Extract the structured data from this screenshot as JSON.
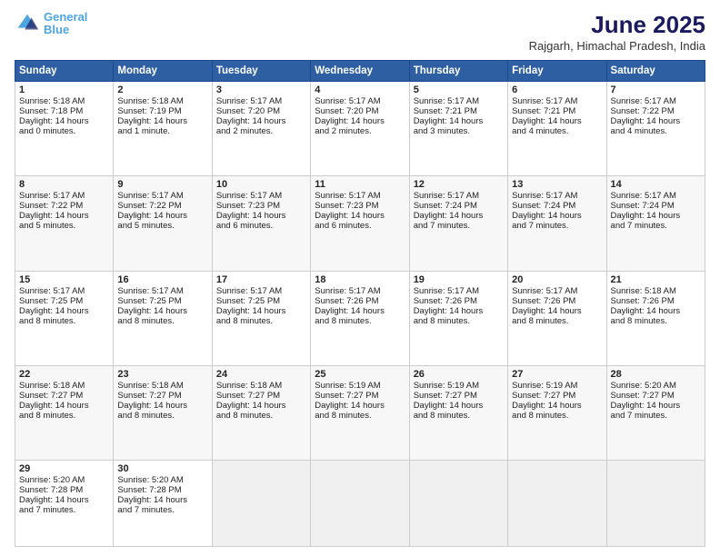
{
  "logo": {
    "line1": "General",
    "line2": "Blue"
  },
  "header": {
    "title": "June 2025",
    "subtitle": "Rajgarh, Himachal Pradesh, India"
  },
  "weekdays": [
    "Sunday",
    "Monday",
    "Tuesday",
    "Wednesday",
    "Thursday",
    "Friday",
    "Saturday"
  ],
  "weeks": [
    [
      {
        "day": "1",
        "lines": [
          "Sunrise: 5:18 AM",
          "Sunset: 7:18 PM",
          "Daylight: 14 hours",
          "and 0 minutes."
        ]
      },
      {
        "day": "2",
        "lines": [
          "Sunrise: 5:18 AM",
          "Sunset: 7:19 PM",
          "Daylight: 14 hours",
          "and 1 minute."
        ]
      },
      {
        "day": "3",
        "lines": [
          "Sunrise: 5:17 AM",
          "Sunset: 7:20 PM",
          "Daylight: 14 hours",
          "and 2 minutes."
        ]
      },
      {
        "day": "4",
        "lines": [
          "Sunrise: 5:17 AM",
          "Sunset: 7:20 PM",
          "Daylight: 14 hours",
          "and 2 minutes."
        ]
      },
      {
        "day": "5",
        "lines": [
          "Sunrise: 5:17 AM",
          "Sunset: 7:21 PM",
          "Daylight: 14 hours",
          "and 3 minutes."
        ]
      },
      {
        "day": "6",
        "lines": [
          "Sunrise: 5:17 AM",
          "Sunset: 7:21 PM",
          "Daylight: 14 hours",
          "and 4 minutes."
        ]
      },
      {
        "day": "7",
        "lines": [
          "Sunrise: 5:17 AM",
          "Sunset: 7:22 PM",
          "Daylight: 14 hours",
          "and 4 minutes."
        ]
      }
    ],
    [
      {
        "day": "8",
        "lines": [
          "Sunrise: 5:17 AM",
          "Sunset: 7:22 PM",
          "Daylight: 14 hours",
          "and 5 minutes."
        ]
      },
      {
        "day": "9",
        "lines": [
          "Sunrise: 5:17 AM",
          "Sunset: 7:22 PM",
          "Daylight: 14 hours",
          "and 5 minutes."
        ]
      },
      {
        "day": "10",
        "lines": [
          "Sunrise: 5:17 AM",
          "Sunset: 7:23 PM",
          "Daylight: 14 hours",
          "and 6 minutes."
        ]
      },
      {
        "day": "11",
        "lines": [
          "Sunrise: 5:17 AM",
          "Sunset: 7:23 PM",
          "Daylight: 14 hours",
          "and 6 minutes."
        ]
      },
      {
        "day": "12",
        "lines": [
          "Sunrise: 5:17 AM",
          "Sunset: 7:24 PM",
          "Daylight: 14 hours",
          "and 7 minutes."
        ]
      },
      {
        "day": "13",
        "lines": [
          "Sunrise: 5:17 AM",
          "Sunset: 7:24 PM",
          "Daylight: 14 hours",
          "and 7 minutes."
        ]
      },
      {
        "day": "14",
        "lines": [
          "Sunrise: 5:17 AM",
          "Sunset: 7:24 PM",
          "Daylight: 14 hours",
          "and 7 minutes."
        ]
      }
    ],
    [
      {
        "day": "15",
        "lines": [
          "Sunrise: 5:17 AM",
          "Sunset: 7:25 PM",
          "Daylight: 14 hours",
          "and 8 minutes."
        ]
      },
      {
        "day": "16",
        "lines": [
          "Sunrise: 5:17 AM",
          "Sunset: 7:25 PM",
          "Daylight: 14 hours",
          "and 8 minutes."
        ]
      },
      {
        "day": "17",
        "lines": [
          "Sunrise: 5:17 AM",
          "Sunset: 7:25 PM",
          "Daylight: 14 hours",
          "and 8 minutes."
        ]
      },
      {
        "day": "18",
        "lines": [
          "Sunrise: 5:17 AM",
          "Sunset: 7:26 PM",
          "Daylight: 14 hours",
          "and 8 minutes."
        ]
      },
      {
        "day": "19",
        "lines": [
          "Sunrise: 5:17 AM",
          "Sunset: 7:26 PM",
          "Daylight: 14 hours",
          "and 8 minutes."
        ]
      },
      {
        "day": "20",
        "lines": [
          "Sunrise: 5:17 AM",
          "Sunset: 7:26 PM",
          "Daylight: 14 hours",
          "and 8 minutes."
        ]
      },
      {
        "day": "21",
        "lines": [
          "Sunrise: 5:18 AM",
          "Sunset: 7:26 PM",
          "Daylight: 14 hours",
          "and 8 minutes."
        ]
      }
    ],
    [
      {
        "day": "22",
        "lines": [
          "Sunrise: 5:18 AM",
          "Sunset: 7:27 PM",
          "Daylight: 14 hours",
          "and 8 minutes."
        ]
      },
      {
        "day": "23",
        "lines": [
          "Sunrise: 5:18 AM",
          "Sunset: 7:27 PM",
          "Daylight: 14 hours",
          "and 8 minutes."
        ]
      },
      {
        "day": "24",
        "lines": [
          "Sunrise: 5:18 AM",
          "Sunset: 7:27 PM",
          "Daylight: 14 hours",
          "and 8 minutes."
        ]
      },
      {
        "day": "25",
        "lines": [
          "Sunrise: 5:19 AM",
          "Sunset: 7:27 PM",
          "Daylight: 14 hours",
          "and 8 minutes."
        ]
      },
      {
        "day": "26",
        "lines": [
          "Sunrise: 5:19 AM",
          "Sunset: 7:27 PM",
          "Daylight: 14 hours",
          "and 8 minutes."
        ]
      },
      {
        "day": "27",
        "lines": [
          "Sunrise: 5:19 AM",
          "Sunset: 7:27 PM",
          "Daylight: 14 hours",
          "and 8 minutes."
        ]
      },
      {
        "day": "28",
        "lines": [
          "Sunrise: 5:20 AM",
          "Sunset: 7:27 PM",
          "Daylight: 14 hours",
          "and 7 minutes."
        ]
      }
    ],
    [
      {
        "day": "29",
        "lines": [
          "Sunrise: 5:20 AM",
          "Sunset: 7:28 PM",
          "Daylight: 14 hours",
          "and 7 minutes."
        ]
      },
      {
        "day": "30",
        "lines": [
          "Sunrise: 5:20 AM",
          "Sunset: 7:28 PM",
          "Daylight: 14 hours",
          "and 7 minutes."
        ]
      },
      {
        "day": "",
        "lines": []
      },
      {
        "day": "",
        "lines": []
      },
      {
        "day": "",
        "lines": []
      },
      {
        "day": "",
        "lines": []
      },
      {
        "day": "",
        "lines": []
      }
    ]
  ]
}
